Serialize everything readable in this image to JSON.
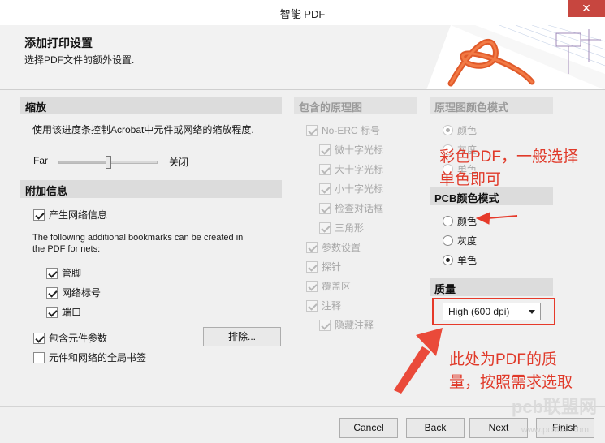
{
  "window": {
    "title": "智能 PDF",
    "close_glyph": "✕"
  },
  "header": {
    "title": "添加打印设置",
    "subtitle": "选择PDF文件的额外设置."
  },
  "zoom": {
    "heading": "缩放",
    "description": "使用该进度条控制Acrobat中元件或网络的缩放程度.",
    "left_label": "Far",
    "right_label": "关闭",
    "level": 0.5
  },
  "additional_info": {
    "heading": "附加信息",
    "net_info_label": "产生网络信息",
    "bookmarks_text_line1": "The following additional bookmarks can be created in",
    "bookmarks_text_line2": "the PDF for nets:",
    "pins_label": "管脚",
    "net_labels_label": "网络标号",
    "ports_label": "端口",
    "component_params_label": "包含元件参数",
    "exclude_button": "排除...",
    "global_bookmarks_label": "元件和网络的全局书签"
  },
  "schematics": {
    "heading": "包含的原理图",
    "no_erc_label": "No-ERC 标号",
    "micro_cross_label": "微十字光标",
    "large_cross_label": "大十字光标",
    "small_cross_label": "小十字光标",
    "check_dialog_label": "检查对话框",
    "triangle_label": "三角形",
    "param_settings_label": "参数设置",
    "probe_label": "探针",
    "cover_area_label": "覆盖区",
    "notes_label": "注释",
    "hide_notes_label": "隐藏注释"
  },
  "schematic_color": {
    "heading": "原理图颜色模式",
    "color_label": "颜色",
    "gray_label": "灰度",
    "mono_label": "单色"
  },
  "pcb_color": {
    "heading": "PCB颜色模式",
    "color_label": "颜色",
    "gray_label": "灰度",
    "mono_label": "单色"
  },
  "quality": {
    "heading": "质量",
    "selected": "High (600 dpi)"
  },
  "annotations": {
    "note1_line1": "彩色PDF，一般选择",
    "note1_line2": "单色即可",
    "note2_line1": "此处为PDF的质",
    "note2_line2": "量，按照需求选取",
    "color": "#e03a2a"
  },
  "footer": {
    "cancel": "Cancel",
    "back": "Back",
    "next": "Next",
    "finish": "Finish"
  },
  "watermark": {
    "main": "pcb联盟网",
    "url": "www.pcbbar.com"
  }
}
